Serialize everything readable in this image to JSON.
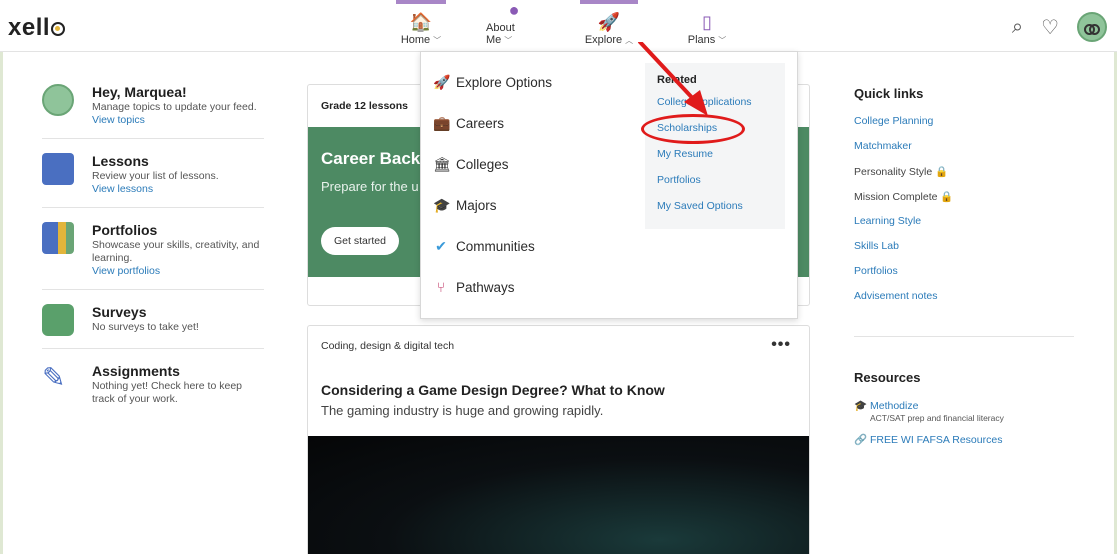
{
  "header": {
    "logo": "xello",
    "nav": [
      {
        "label": "Home",
        "icon": "home-icon"
      },
      {
        "label": "About Me",
        "icon": "person-icon"
      },
      {
        "label": "Explore",
        "icon": "rocket-icon"
      },
      {
        "label": "Plans",
        "icon": "clipboard-icon"
      }
    ]
  },
  "left": {
    "greeting": {
      "title": "Hey, Marquea!",
      "desc": "Manage topics to update your feed.",
      "link": "View topics"
    },
    "lessons": {
      "title": "Lessons",
      "desc": "Review your list of lessons.",
      "link": "View lessons"
    },
    "portfolios": {
      "title": "Portfolios",
      "desc": "Showcase your skills, creativity, and learning.",
      "link": "View portfolios"
    },
    "surveys": {
      "title": "Surveys",
      "desc": "No surveys to take yet!"
    },
    "assignments": {
      "title": "Assignments",
      "desc": "Nothing yet! Check here to keep track of your work."
    }
  },
  "card1": {
    "header": "Grade 12 lessons",
    "title": "Career Back",
    "desc": "Prepare for the u plan",
    "button": "Get started"
  },
  "card2": {
    "tag": "Coding, design & digital tech",
    "more": "•••",
    "title": "Considering a Game Design Degree? What to Know",
    "desc": "The gaming industry is huge and growing rapidly."
  },
  "dropdown": {
    "items": [
      "Explore Options",
      "Careers",
      "Colleges",
      "Majors",
      "Communities",
      "Pathways"
    ],
    "related_header": "Related",
    "related": [
      "College Applications",
      "Scholarships",
      "My Resume",
      "Portfolios",
      "My Saved Options"
    ]
  },
  "quick_links": {
    "header": "Quick links",
    "items": [
      {
        "label": "College Planning",
        "locked": false
      },
      {
        "label": "Matchmaker",
        "locked": false
      },
      {
        "label": "Personality Style",
        "locked": true
      },
      {
        "label": "Mission Complete",
        "locked": true
      },
      {
        "label": "Learning Style",
        "locked": false
      },
      {
        "label": "Skills Lab",
        "locked": false
      },
      {
        "label": "Portfolios",
        "locked": false
      },
      {
        "label": "Advisement notes",
        "locked": false
      }
    ]
  },
  "resources": {
    "header": "Resources",
    "methodize": "Methodize",
    "methodize_sub": "ACT/SAT prep and financial literacy",
    "fafsa": "FREE WI FAFSA Resources"
  },
  "colors": {
    "accent": "#a886c7",
    "link": "#2b7bb9",
    "green": "#4d8a63",
    "annotation": "#e01b1b"
  }
}
